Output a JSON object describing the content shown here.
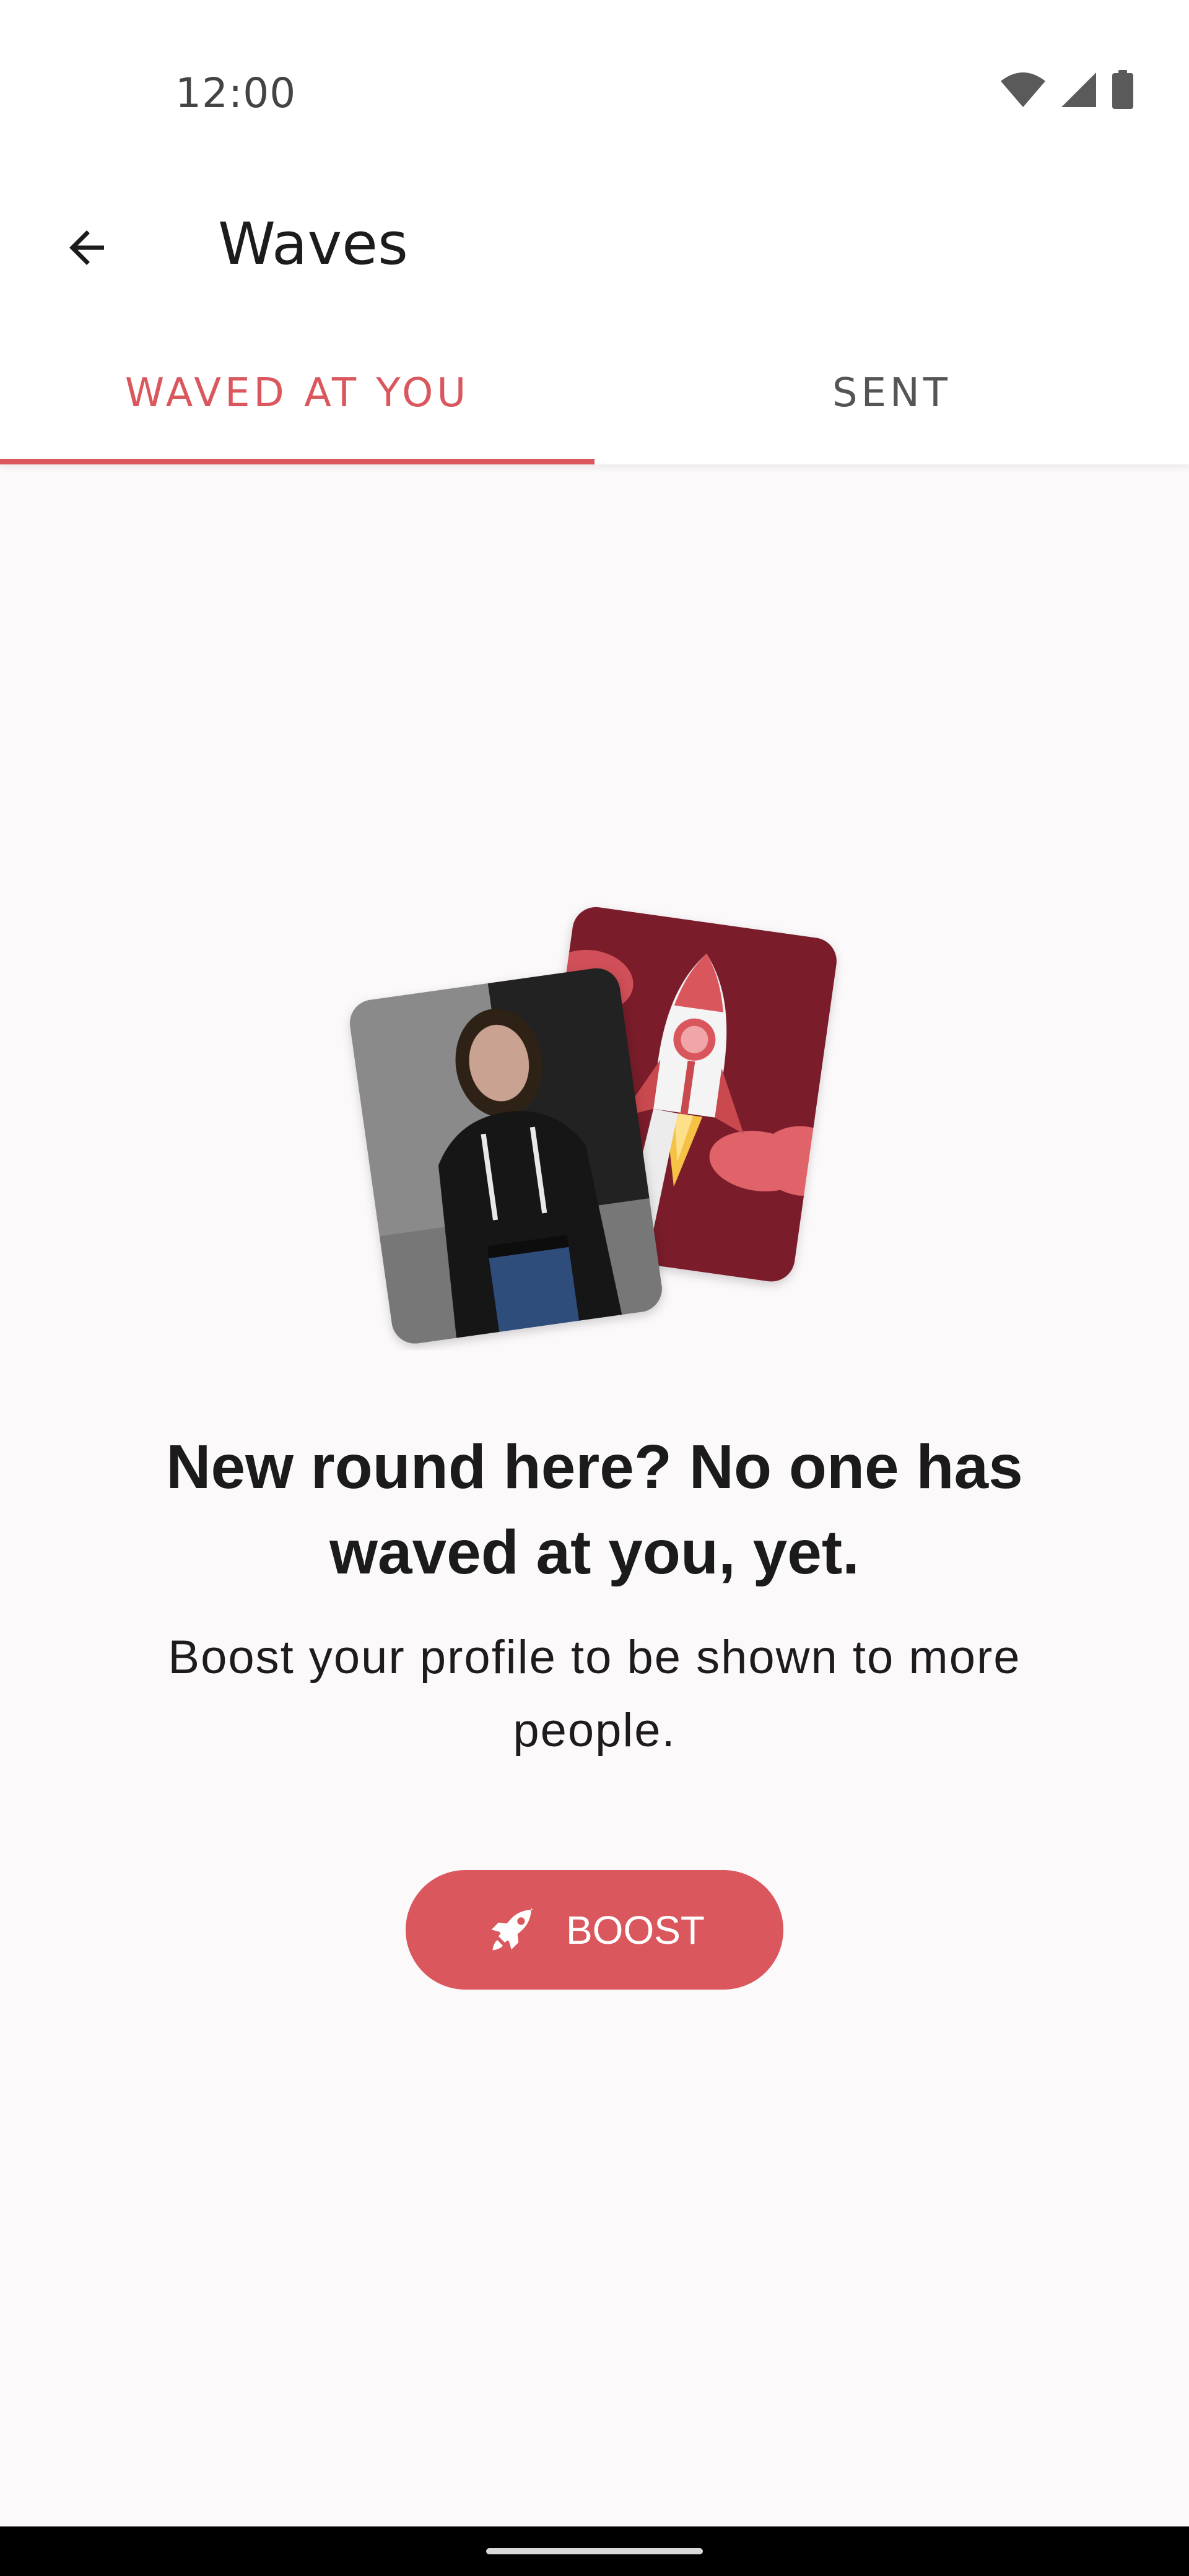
{
  "status_bar": {
    "time": "12:00",
    "icons": [
      "wifi-icon",
      "signal-icon",
      "battery-icon"
    ]
  },
  "app_bar": {
    "back_icon": "arrow-back-icon",
    "title": "Waves"
  },
  "tabs": [
    {
      "label": "WAVED AT YOU",
      "selected": true
    },
    {
      "label": "SENT",
      "selected": false
    }
  ],
  "empty_state": {
    "heading": "New round here? No one has waved at you, yet.",
    "body": "Boost your profile to be shown to more people.",
    "boost_button": {
      "icon": "rocket-icon",
      "label": "BOOST"
    }
  },
  "colors": {
    "accent": "#d9575d",
    "card_maroon": "#7a1a2a",
    "background": "#fcf9fb"
  }
}
